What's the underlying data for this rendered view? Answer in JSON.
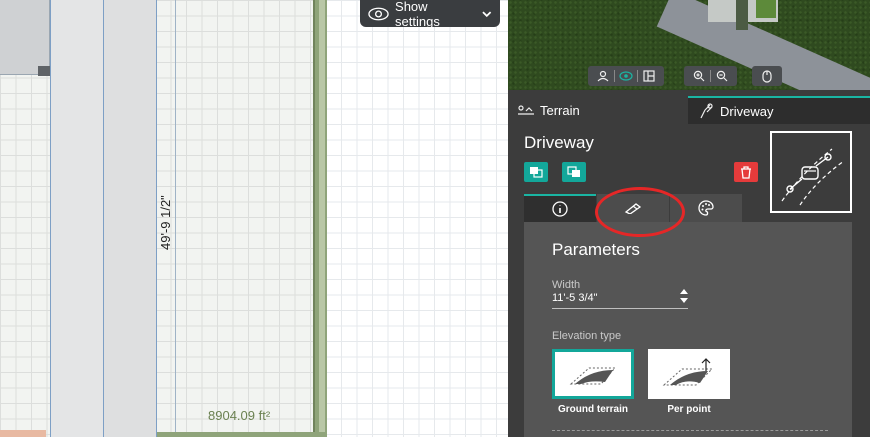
{
  "toolbar": {
    "show_settings_label": "Show settings",
    "icons": [
      "eye-icon",
      "chevron-down-icon"
    ]
  },
  "plan": {
    "dimension_label": "49'-9 1/2\"",
    "area_label": "8904.09 ft²"
  },
  "view_controls": {
    "groups": [
      [
        "person-view-icon",
        "eye-view-icon",
        "layers-icon"
      ],
      [
        "zoom-in-icon",
        "zoom-out-icon"
      ],
      [
        "mouse-icon"
      ]
    ]
  },
  "tabs": [
    {
      "label": "Terrain",
      "icon": "terrain-icon",
      "active": false
    },
    {
      "label": "Driveway",
      "icon": "driveway-tool-icon",
      "active": true
    }
  ],
  "panel": {
    "title": "Driveway",
    "actions": [
      "bring-front-icon",
      "send-back-icon",
      "trash-icon"
    ],
    "subtabs": [
      "info-icon",
      "pen-icon",
      "palette-icon"
    ],
    "parameters_title": "Parameters",
    "width": {
      "label": "Width",
      "value": "11'-5 3/4\""
    },
    "elevation": {
      "label": "Elevation type",
      "options": [
        {
          "label": "Ground terrain",
          "selected": true
        },
        {
          "label": "Per point",
          "selected": false
        }
      ]
    }
  },
  "colors": {
    "accent": "#13a79a",
    "danger": "#e53b3b",
    "highlight": "#e52727"
  }
}
